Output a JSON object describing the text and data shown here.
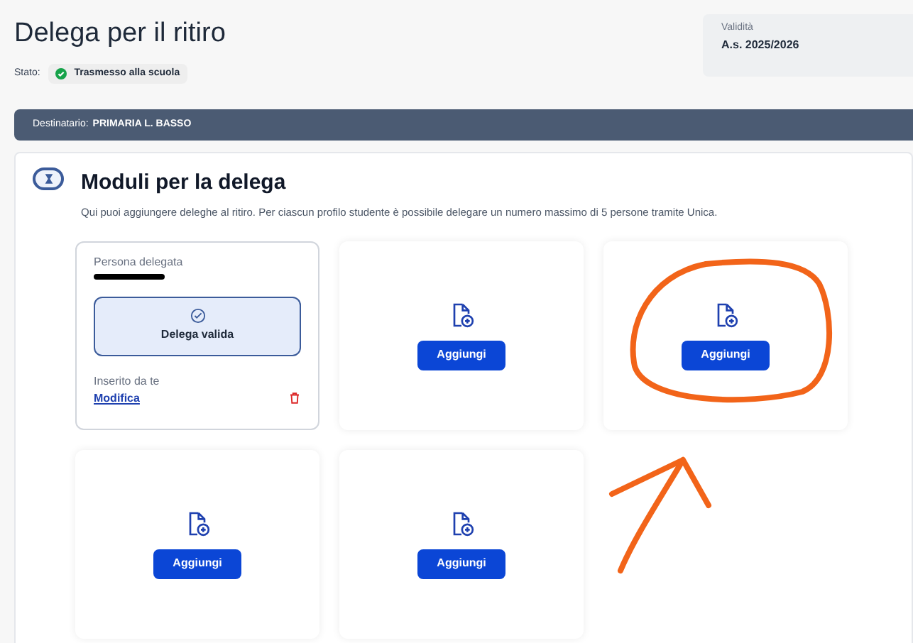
{
  "header": {
    "title": "Delega per il ritiro",
    "status_label": "Stato:",
    "status": "Trasmesso alla scuola"
  },
  "validity": {
    "label": "Validità",
    "value": "A.s. 2025/2026"
  },
  "recipient_bar": {
    "label": "Destinatario:",
    "value": "PRIMARIA L. BASSO"
  },
  "section": {
    "title": "Moduli per la delega",
    "description": "Qui puoi aggiungere deleghe al ritiro. Per ciascun profilo studente è possibile delegare un numero massimo di 5 persone tramite Unica.",
    "cards": [
      {
        "kind": "delegate",
        "label": "Persona delegata",
        "badge": "Delega valida",
        "inserted_by": "Inserito da te",
        "edit_link": "Modifica"
      },
      {
        "kind": "empty",
        "button": "Aggiungi",
        "circled": false
      },
      {
        "kind": "empty",
        "button": "Aggiungi",
        "circled": true
      },
      {
        "kind": "empty",
        "button": "Aggiungi",
        "circled": false
      },
      {
        "kind": "empty",
        "button": "Aggiungi",
        "circled": false
      }
    ]
  }
}
